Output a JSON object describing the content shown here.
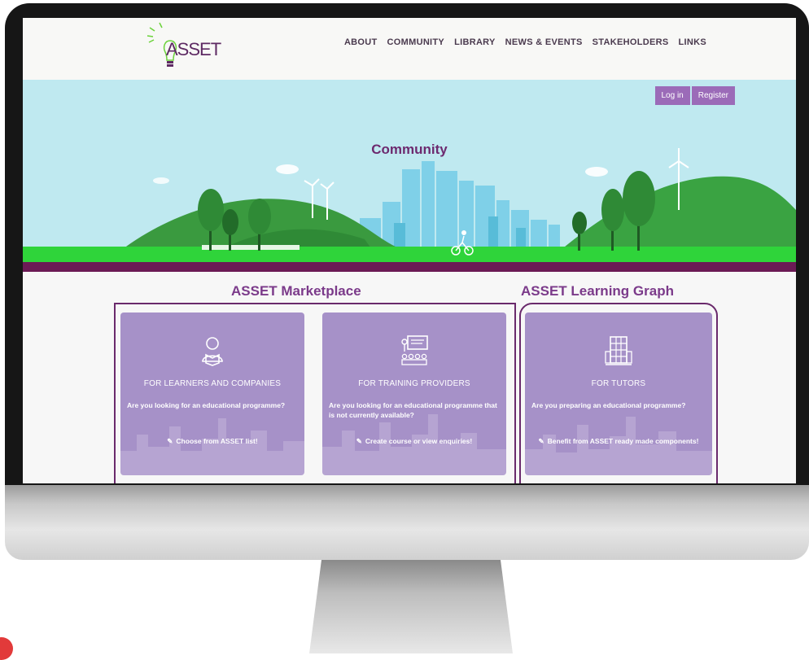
{
  "brand": {
    "logo_text": "ASSET"
  },
  "nav": {
    "items": [
      {
        "label": "ABOUT"
      },
      {
        "label": "COMMUNITY"
      },
      {
        "label": "LIBRARY"
      },
      {
        "label": "NEWS & EVENTS"
      },
      {
        "label": "STAKEHOLDERS"
      },
      {
        "label": "LINKS"
      }
    ]
  },
  "auth": {
    "login_label": "Log in",
    "register_label": "Register"
  },
  "hero": {
    "title": "Community"
  },
  "sections": {
    "marketplace_title": "ASSET Marketplace",
    "learning_graph_title": "ASSET Learning Graph"
  },
  "cards": [
    {
      "title": "FOR LEARNERS AND COMPANIES",
      "description": "Are you looking for an educational programme?",
      "link": "Choose from ASSET list!",
      "icon": "reader-icon"
    },
    {
      "title": "FOR TRAINING PROVIDERS",
      "description": "Are you looking for an educational programme that is not currently available?",
      "link": "Create course or view enquiries!",
      "icon": "classroom-icon"
    },
    {
      "title": "FOR TUTORS",
      "description": "Are you preparing an educational programme?",
      "link": "Benefit from ASSET ready made components!",
      "icon": "building-blocks-icon"
    }
  ],
  "colors": {
    "brand_purple": "#6d2a6f",
    "card_purple": "#a691c8",
    "button_purple": "#9b6bb8",
    "hero_sky": "#bfe9f0",
    "grass_green": "#2fd43a"
  }
}
